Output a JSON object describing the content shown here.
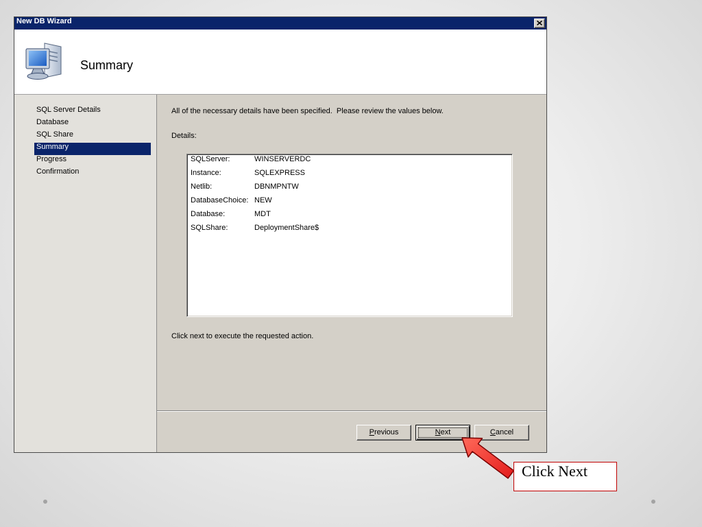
{
  "window": {
    "title": "New DB Wizard",
    "close_icon": "close-icon"
  },
  "header": {
    "title": "Summary",
    "icon": "computer-document-icon"
  },
  "sidebar": {
    "items": [
      {
        "label": "SQL Server Details",
        "selected": false
      },
      {
        "label": "Database",
        "selected": false
      },
      {
        "label": "SQL Share",
        "selected": false
      },
      {
        "label": "Summary",
        "selected": true
      },
      {
        "label": "Progress",
        "selected": false
      },
      {
        "label": "Confirmation",
        "selected": false
      }
    ]
  },
  "main": {
    "intro": "All of the necessary details have been specified.  Please review the values below.",
    "details_label": "Details:",
    "details": [
      {
        "key": "SQLServer:",
        "value": "WINSERVERDC"
      },
      {
        "key": "Instance:",
        "value": "SQLEXPRESS"
      },
      {
        "key": "Netlib:",
        "value": "DBNMPNTW"
      },
      {
        "key": "DatabaseChoice:",
        "value": "NEW"
      },
      {
        "key": "Database:",
        "value": "MDT"
      },
      {
        "key": "SQLShare:",
        "value": "DeploymentShare$"
      }
    ],
    "instruction": "Click next to execute the requested action."
  },
  "buttons": {
    "previous": {
      "label": "Previous",
      "focused": false
    },
    "next": {
      "label": "Next",
      "focused": true
    },
    "cancel": {
      "label": "Cancel",
      "focused": false
    }
  },
  "annotation": {
    "callout_text": "Click Next",
    "pointer_icon": "red-arrow-icon"
  },
  "colors": {
    "title_bar": "#0a246a",
    "selection": "#0a246a",
    "dialog_face": "#d4d0c8",
    "arrow": "#e31b1b",
    "callout_border": "#c00000"
  }
}
